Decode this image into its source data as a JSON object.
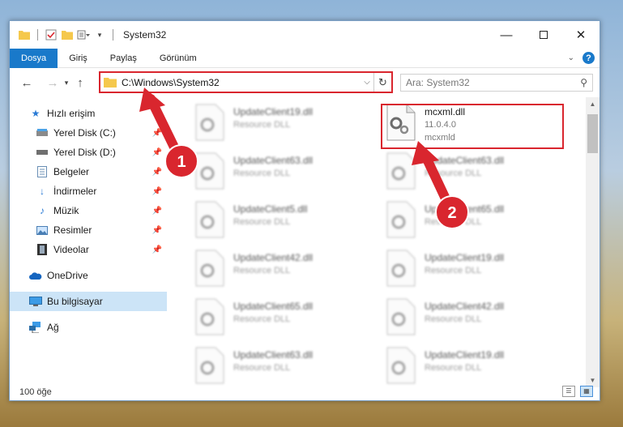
{
  "window": {
    "title": "System32",
    "quick_access_icons": [
      "folder-icon",
      "properties-icon",
      "new-folder-icon",
      "customize-icon"
    ],
    "controls": [
      "minimize-icon",
      "maximize-icon",
      "close-icon"
    ]
  },
  "ribbon": {
    "tabs": [
      "Dosya",
      "Giriş",
      "Paylaş",
      "Görünüm"
    ],
    "active_tab": "Dosya",
    "help_glyph": "?"
  },
  "navigation": {
    "address_path": "C:\\Windows\\System32",
    "search_placeholder": "Ara: System32"
  },
  "sidebar": {
    "items": [
      {
        "label": "Hızlı erişim",
        "icon": "star-icon",
        "pinned": false
      },
      {
        "label": "Yerel Disk (C:)",
        "icon": "drive-icon",
        "pinned": true
      },
      {
        "label": "Yerel Disk (D:)",
        "icon": "drive-icon",
        "pinned": true
      },
      {
        "label": "Belgeler",
        "icon": "documents-icon",
        "pinned": true
      },
      {
        "label": "İndirmeler",
        "icon": "download-icon",
        "pinned": true
      },
      {
        "label": "Müzik",
        "icon": "music-icon",
        "pinned": true
      },
      {
        "label": "Resimler",
        "icon": "pictures-icon",
        "pinned": true
      },
      {
        "label": "Videolar",
        "icon": "video-icon",
        "pinned": true
      },
      {
        "label": "OneDrive",
        "icon": "cloud-icon",
        "pinned": false
      },
      {
        "label": "Bu bilgisayar",
        "icon": "computer-icon",
        "pinned": false
      },
      {
        "label": "Ağ",
        "icon": "network-icon",
        "pinned": false
      }
    ],
    "selected": "Bu bilgisayar"
  },
  "files": {
    "left_column": [
      {
        "name": "UpdateClient19.dll",
        "desc": "Resource DLL"
      },
      {
        "name": "UpdateClient63.dll",
        "desc": "Resource DLL"
      },
      {
        "name": "UpdateClient5.dll",
        "desc": "Resource DLL"
      },
      {
        "name": "UpdateClient42.dll",
        "desc": "Resource DLL"
      },
      {
        "name": "UpdateClient65.dll",
        "desc": "Resource DLL"
      },
      {
        "name": "UpdateClient63.dll",
        "desc": "Resource DLL"
      }
    ],
    "right_column": [
      {
        "name": "mcxml.dll",
        "desc": "11.0.4.0",
        "extra": "mcxmld",
        "highlighted": true
      },
      {
        "name": "UpdateClient63.dll",
        "desc": "Resource DLL"
      },
      {
        "name": "UpdateClient65.dll",
        "desc": "Resource DLL"
      },
      {
        "name": "UpdateClient19.dll",
        "desc": "Resource DLL"
      },
      {
        "name": "UpdateClient42.dll",
        "desc": "Resource DLL"
      },
      {
        "name": "UpdateClient19.dll",
        "desc": "Resource DLL"
      }
    ]
  },
  "status": {
    "item_count": "100 öğe"
  },
  "annotations": {
    "marker_1": "1",
    "marker_2": "2",
    "color": "#d9262e"
  },
  "colors": {
    "accent": "#1979ca",
    "highlight_border": "#d9262e",
    "selection": "#cce4f7"
  }
}
